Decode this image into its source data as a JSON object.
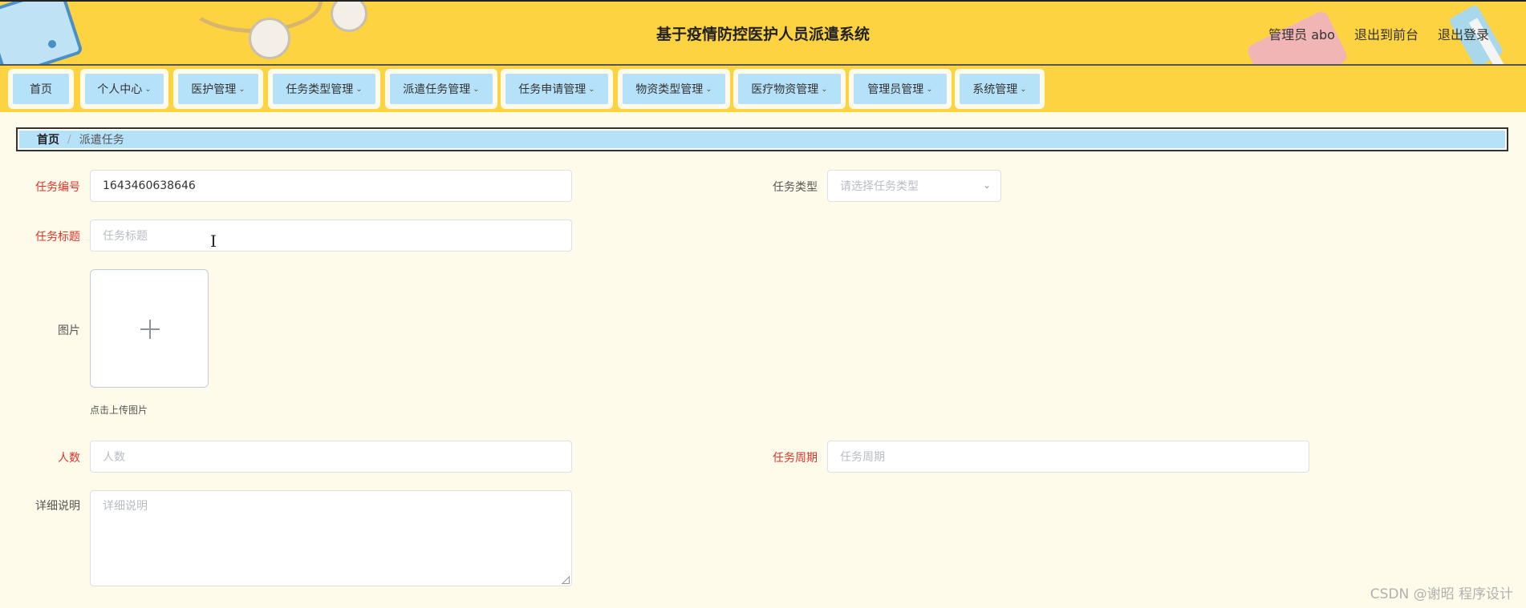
{
  "header": {
    "title": "基于疫情防控医护人员派遣系统",
    "user_label": "管理员 abo",
    "front_label": "退出到前台",
    "logout_label": "退出登录"
  },
  "nav": [
    {
      "label": "首页",
      "has_dropdown": false
    },
    {
      "label": "个人中心",
      "has_dropdown": true
    },
    {
      "label": "医护管理",
      "has_dropdown": true
    },
    {
      "label": "任务类型管理",
      "has_dropdown": true
    },
    {
      "label": "派遣任务管理",
      "has_dropdown": true
    },
    {
      "label": "任务申请管理",
      "has_dropdown": true
    },
    {
      "label": "物资类型管理",
      "has_dropdown": true
    },
    {
      "label": "医疗物资管理",
      "has_dropdown": true
    },
    {
      "label": "管理员管理",
      "has_dropdown": true
    },
    {
      "label": "系统管理",
      "has_dropdown": true
    }
  ],
  "breadcrumb": {
    "home": "首页",
    "separator": "/",
    "current": "派遣任务"
  },
  "form": {
    "task_no": {
      "label": "任务编号",
      "value": "1643460638646"
    },
    "task_type": {
      "label": "任务类型",
      "placeholder": "请选择任务类型"
    },
    "task_title": {
      "label": "任务标题",
      "placeholder": "任务标题"
    },
    "image": {
      "label": "图片",
      "tip": "点击上传图片"
    },
    "people": {
      "label": "人数",
      "placeholder": "人数"
    },
    "period": {
      "label": "任务周期",
      "placeholder": "任务周期"
    },
    "detail": {
      "label": "详细说明",
      "placeholder": "详细说明"
    }
  },
  "watermark": "CSDN @谢昭  程序设计",
  "colors": {
    "header_bg": "#fdd341",
    "nav_item_bg": "#b5e2f8",
    "page_bg": "#fffbea",
    "required_label": "#d9342b"
  }
}
